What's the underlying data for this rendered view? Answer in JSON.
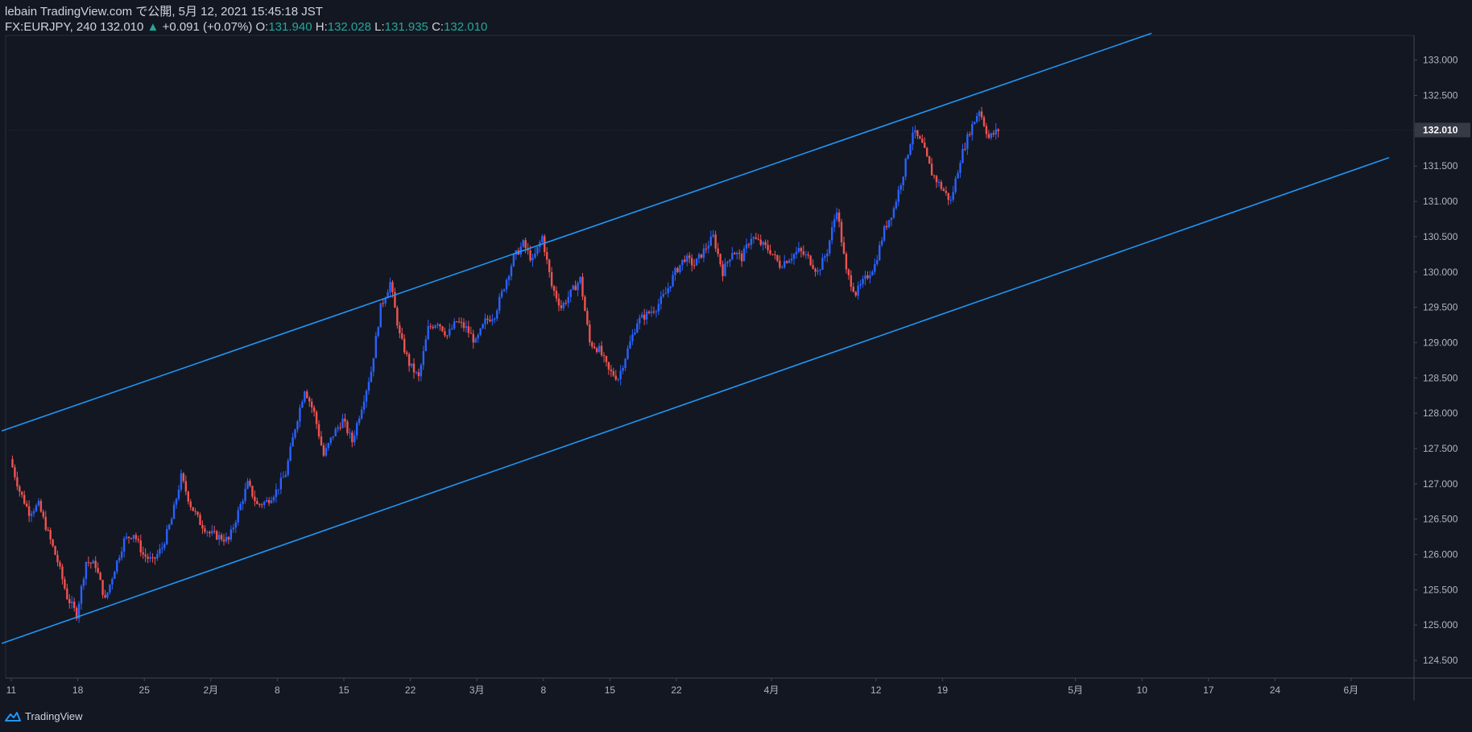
{
  "header": {
    "line1": "lebain TradingView.com で公開, 5月 12, 2021 15:45:18 JST",
    "symbol": "FX:EURJPY, 240",
    "last": "132.010",
    "change": "+0.091 (+0.07%)",
    "o_label": "O:",
    "o_value": "131.940",
    "h_label": "H:",
    "h_value": "132.028",
    "l_label": "L:",
    "l_value": "131.935",
    "c_label": "C:",
    "c_value": "132.010"
  },
  "footer": {
    "brand": "TradingView"
  },
  "colors": {
    "background": "#131722",
    "up": "#2962ff",
    "down": "#ef5350",
    "channel": "#2196f3",
    "axis_text": "#b2b5be",
    "last_price_bg": "#363a45"
  },
  "chart_data": {
    "type": "candlestick",
    "title": "",
    "ylim": [
      124.25,
      133.35
    ],
    "y_ticks": [
      "133.000",
      "132.500",
      "131.500",
      "131.000",
      "130.500",
      "130.000",
      "129.500",
      "129.000",
      "128.500",
      "128.000",
      "127.500",
      "127.000",
      "126.500",
      "126.000",
      "125.500",
      "125.000",
      "124.500"
    ],
    "last_price": "132.010",
    "x_ticks": [
      {
        "label": "11",
        "date": "2021-01-11"
      },
      {
        "label": "18",
        "date": "2021-01-18"
      },
      {
        "label": "25",
        "date": "2021-01-25"
      },
      {
        "label": "2月",
        "date": "2021-02-01"
      },
      {
        "label": "8",
        "date": "2021-02-08"
      },
      {
        "label": "15",
        "date": "2021-02-15"
      },
      {
        "label": "22",
        "date": "2021-02-22"
      },
      {
        "label": "3月",
        "date": "2021-03-01"
      },
      {
        "label": "8",
        "date": "2021-03-08"
      },
      {
        "label": "15",
        "date": "2021-03-15"
      },
      {
        "label": "22",
        "date": "2021-03-22"
      },
      {
        "label": "4月",
        "date": "2021-04-01"
      },
      {
        "label": "12",
        "date": "2021-04-12"
      },
      {
        "label": "19",
        "date": "2021-04-19"
      },
      {
        "label": "5月",
        "date": "2021-05-03"
      },
      {
        "label": "10",
        "date": "2021-05-10"
      },
      {
        "label": "17",
        "date": "2021-05-17"
      },
      {
        "label": "24",
        "date": "2021-05-24"
      },
      {
        "label": "6月",
        "date": "2021-06-01"
      }
    ],
    "price_path": [
      [
        "2021-01-11",
        127.35
      ],
      [
        "2021-01-12",
        126.9
      ],
      [
        "2021-01-13",
        126.6
      ],
      [
        "2021-01-14",
        126.7
      ],
      [
        "2021-01-15",
        126.3
      ],
      [
        "2021-01-16",
        125.9
      ],
      [
        "2021-01-17",
        125.4
      ],
      [
        "2021-01-18",
        125.15
      ],
      [
        "2021-01-19",
        125.9
      ],
      [
        "2021-01-20",
        125.85
      ],
      [
        "2021-01-21",
        125.35
      ],
      [
        "2021-01-22",
        125.8
      ],
      [
        "2021-01-23",
        126.2
      ],
      [
        "2021-01-24",
        126.3
      ],
      [
        "2021-01-25",
        126.0
      ],
      [
        "2021-01-26",
        125.9
      ],
      [
        "2021-01-27",
        126.1
      ],
      [
        "2021-01-28",
        126.5
      ],
      [
        "2021-01-29",
        127.1
      ],
      [
        "2021-01-30",
        126.7
      ],
      [
        "2021-01-31",
        126.45
      ],
      [
        "2021-02-01",
        126.3
      ],
      [
        "2021-02-02",
        126.25
      ],
      [
        "2021-02-03",
        126.2
      ],
      [
        "2021-02-04",
        126.6
      ],
      [
        "2021-02-05",
        127.0
      ],
      [
        "2021-02-06",
        126.7
      ],
      [
        "2021-02-07",
        126.75
      ],
      [
        "2021-02-08",
        126.9
      ],
      [
        "2021-02-09",
        127.15
      ],
      [
        "2021-02-10",
        127.8
      ],
      [
        "2021-02-11",
        128.35
      ],
      [
        "2021-02-12",
        128.0
      ],
      [
        "2021-02-13",
        127.4
      ],
      [
        "2021-02-14",
        127.7
      ],
      [
        "2021-02-15",
        127.9
      ],
      [
        "2021-02-16",
        127.6
      ],
      [
        "2021-02-17",
        128.1
      ],
      [
        "2021-02-18",
        128.6
      ],
      [
        "2021-02-19",
        129.5
      ],
      [
        "2021-02-20",
        129.85
      ],
      [
        "2021-02-21",
        129.1
      ],
      [
        "2021-02-22",
        128.7
      ],
      [
        "2021-02-23",
        128.5
      ],
      [
        "2021-02-24",
        129.2
      ],
      [
        "2021-02-25",
        129.3
      ],
      [
        "2021-02-26",
        129.1
      ],
      [
        "2021-02-27",
        129.3
      ],
      [
        "2021-02-28",
        129.2
      ],
      [
        "2021-03-01",
        129.0
      ],
      [
        "2021-03-02",
        129.3
      ],
      [
        "2021-03-03",
        129.4
      ],
      [
        "2021-03-04",
        129.8
      ],
      [
        "2021-03-05",
        130.2
      ],
      [
        "2021-03-06",
        130.4
      ],
      [
        "2021-03-07",
        130.15
      ],
      [
        "2021-03-08",
        130.5
      ],
      [
        "2021-03-09",
        129.8
      ],
      [
        "2021-03-10",
        129.5
      ],
      [
        "2021-03-11",
        129.7
      ],
      [
        "2021-03-12",
        129.9
      ],
      [
        "2021-03-13",
        129.0
      ],
      [
        "2021-03-14",
        128.9
      ],
      [
        "2021-03-15",
        128.6
      ],
      [
        "2021-03-16",
        128.5
      ],
      [
        "2021-03-17",
        128.9
      ],
      [
        "2021-03-18",
        129.3
      ],
      [
        "2021-03-19",
        129.4
      ],
      [
        "2021-03-20",
        129.5
      ],
      [
        "2021-03-21",
        129.7
      ],
      [
        "2021-03-22",
        130.0
      ],
      [
        "2021-03-23",
        130.2
      ],
      [
        "2021-03-24",
        130.1
      ],
      [
        "2021-03-25",
        130.3
      ],
      [
        "2021-03-26",
        130.5
      ],
      [
        "2021-03-27",
        130.0
      ],
      [
        "2021-03-28",
        130.3
      ],
      [
        "2021-03-29",
        130.2
      ],
      [
        "2021-03-30",
        130.5
      ],
      [
        "2021-03-31",
        130.4
      ],
      [
        "2021-04-01",
        130.3
      ],
      [
        "2021-04-02",
        130.1
      ],
      [
        "2021-04-03",
        130.2
      ],
      [
        "2021-04-04",
        130.3
      ],
      [
        "2021-04-05",
        130.2
      ],
      [
        "2021-04-06",
        130.0
      ],
      [
        "2021-04-07",
        130.3
      ],
      [
        "2021-04-08",
        130.9
      ],
      [
        "2021-04-09",
        130.0
      ],
      [
        "2021-04-10",
        129.7
      ],
      [
        "2021-04-11",
        129.9
      ],
      [
        "2021-04-12",
        130.1
      ],
      [
        "2021-04-13",
        130.6
      ],
      [
        "2021-04-14",
        130.9
      ],
      [
        "2021-04-15",
        131.4
      ],
      [
        "2021-04-16",
        132.0
      ],
      [
        "2021-04-17",
        131.8
      ],
      [
        "2021-04-18",
        131.4
      ],
      [
        "2021-04-19",
        131.2
      ],
      [
        "2021-04-20",
        131.0
      ],
      [
        "2021-04-21",
        131.6
      ],
      [
        "2021-04-22",
        132.0
      ],
      [
        "2021-04-23",
        132.3
      ],
      [
        "2021-04-24",
        131.9
      ],
      [
        "2021-04-25",
        132.01
      ]
    ],
    "channel": {
      "upper": [
        [
          "2021-01-10",
          127.75
        ],
        [
          "2021-05-11",
          133.38
        ]
      ],
      "lower": [
        [
          "2021-01-10",
          124.74
        ],
        [
          "2021-06-05",
          131.62
        ]
      ]
    }
  }
}
